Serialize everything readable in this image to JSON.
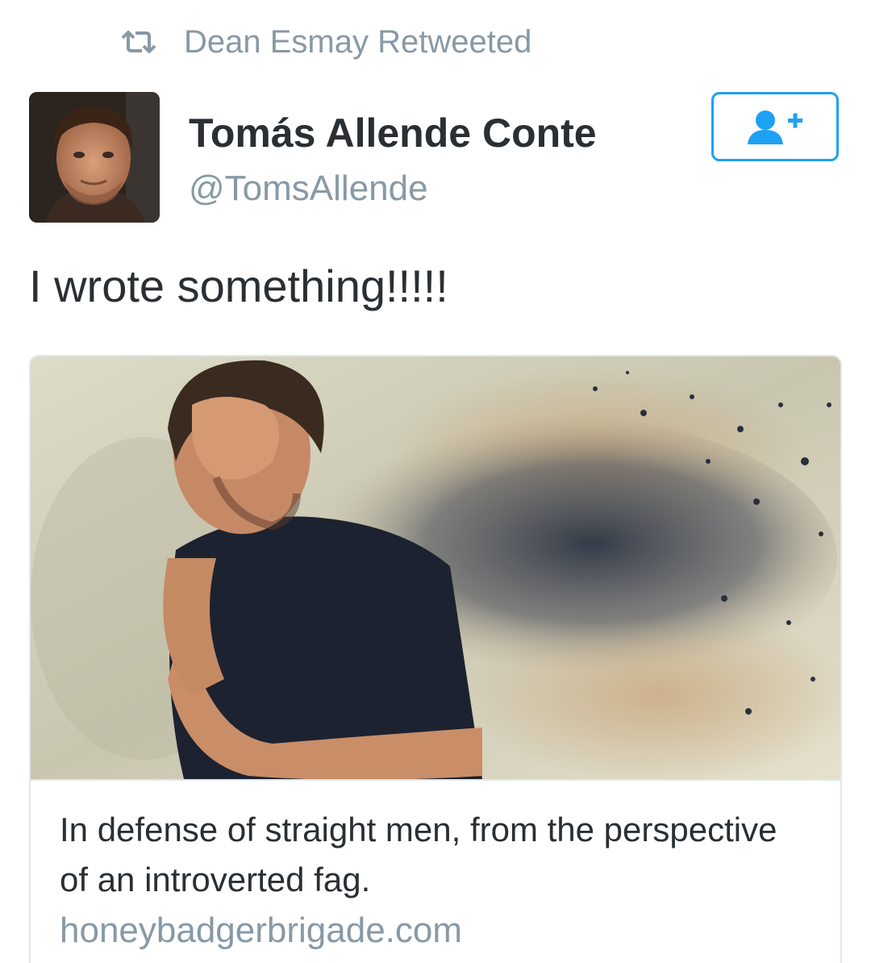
{
  "retweet": {
    "icon": "retweet-icon",
    "text": "Dean Esmay Retweeted"
  },
  "author": {
    "avatar_icon": "user-avatar",
    "display_name": "Tomás Allende Conte",
    "handle": "@TomsAllende"
  },
  "follow_button": {
    "icon": "follow-user-plus-icon",
    "color": "#1da1f2"
  },
  "tweet": {
    "text": "I wrote something!!!!!"
  },
  "card": {
    "image_description_icon": "article-photo",
    "title": "In defense of straight men, from the perspective of an introverted fag.",
    "domain": "honeybadgerbrigade.com"
  },
  "colors": {
    "primary_text": "#292f33",
    "secondary_text": "#8899a6",
    "border": "#e1e8ed",
    "accent": "#1da1f2"
  }
}
